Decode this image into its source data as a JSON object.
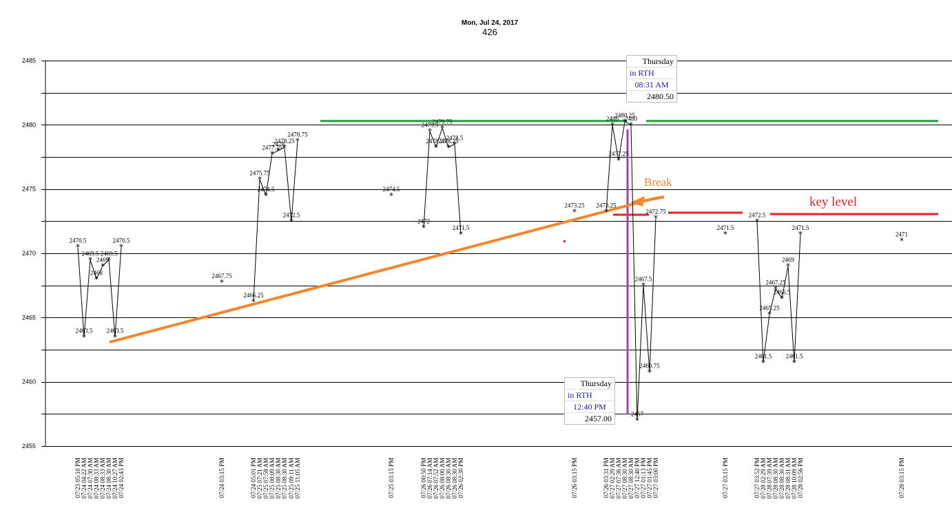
{
  "chart_data": {
    "type": "line",
    "title": "Mon, Jul 24, 2017",
    "subtitle": "426",
    "ylim": [
      2455,
      2485
    ],
    "y_ticks": [
      2455,
      2460,
      2465,
      2470,
      2475,
      2480,
      2485
    ],
    "grid": true,
    "points": [
      {
        "x": "07/23 05:10 PM",
        "y": 2470.5,
        "label": "2470.5"
      },
      {
        "x": "07/24 04:22 AM",
        "y": 2463.5,
        "label": "2463.5"
      },
      {
        "x": "07/24 07:30 AM",
        "y": 2469.5,
        "label": "2469.5"
      },
      {
        "x": "07/24 08:33 AM",
        "y": 2468,
        "label": "2468"
      },
      {
        "x": "07/24 08:33 AM",
        "y": 2469,
        "label": "2469"
      },
      {
        "x": "07/24 08:30 AM",
        "y": 2469.5,
        "label": "2469.5"
      },
      {
        "x": "07/24 10:27 AM",
        "y": 2463.5,
        "label": "2463.5"
      },
      {
        "x": "07/24 02:43 PM",
        "y": 2470.5,
        "label": "2470.5"
      },
      {
        "x": "07/24 03:15 PM",
        "y": 2467.75,
        "label": "2467.75",
        "isolated": true
      },
      {
        "x": "07/24 05:01 PM",
        "y": 2466.25,
        "label": "2466.25"
      },
      {
        "x": "07/25 07:21 AM",
        "y": 2475.75,
        "label": "2475.75"
      },
      {
        "x": "07/25 07:58 AM",
        "y": 2474.5,
        "label": "2474.5"
      },
      {
        "x": "07/25 08:09 AM",
        "y": 2477.75,
        "label": "2477.75"
      },
      {
        "x": "07/25 08:30 AM",
        "y": 2478,
        "label": "2478"
      },
      {
        "x": "07/25 08:30 AM",
        "y": 2478.25,
        "label": "2478.25"
      },
      {
        "x": "07/25 09:11 AM",
        "y": 2472.5,
        "label": "2472.5"
      },
      {
        "x": "07/25 11:05 AM",
        "y": 2478.75,
        "label": "2478.75"
      },
      {
        "x": "07/25 03:15 PM",
        "y": 2474.5,
        "label": "2474.5",
        "isolated": true
      },
      {
        "x": "07/26 00:50 PM",
        "y": 2472,
        "label": "2472"
      },
      {
        "x": "07/26 07:14 AM",
        "y": 2479.5,
        "label": "2479.5"
      },
      {
        "x": "07/26 07:52 AM",
        "y": 2478.25,
        "label": "2478.25"
      },
      {
        "x": "07/26 08:00 AM",
        "y": 2479.75,
        "label": "2479.75"
      },
      {
        "x": "07/26 08:30 AM",
        "y": 2478.25,
        "label": "2478.25"
      },
      {
        "x": "07/26 08:30 AM",
        "y": 2478.5,
        "label": "2478.5"
      },
      {
        "x": "07/26 02:30 PM",
        "y": 2471.5,
        "label": "2471.5"
      },
      {
        "x": "07/26 03:15 PM",
        "y": 2473.25,
        "label": "2473.25",
        "isolated": true
      },
      {
        "x": "07/26 03:31 PM",
        "y": 2473.25,
        "label": "2473.25"
      },
      {
        "x": "07/27 02:29 AM",
        "y": 2480,
        "label": "2480"
      },
      {
        "x": "07/27 07:36 AM",
        "y": 2477.25,
        "label": "2477.25"
      },
      {
        "x": "07/27 08:30 AM",
        "y": 2480.25,
        "label": "2480.25"
      },
      {
        "x": "07/27 08:30 AM",
        "y": 2480,
        "label": "2480"
      },
      {
        "x": "07/27 12:40 PM",
        "y": 2457,
        "label": "2457"
      },
      {
        "x": "07/27 01:13 PM",
        "y": 2467.5,
        "label": "2467.5"
      },
      {
        "x": "07/27 01:45 PM",
        "y": 2460.75,
        "label": "2460.75"
      },
      {
        "x": "07/27 03:00 PM",
        "y": 2472.75,
        "label": "2472.75"
      },
      {
        "x": "07/27 03:15 PM",
        "y": 2471.5,
        "label": "2471.5",
        "isolated": true
      },
      {
        "x": "07/27 03:52 PM",
        "y": 2472.5,
        "label": "2472.5"
      },
      {
        "x": "07/28 02:29 AM",
        "y": 2461.5,
        "label": "2461.5"
      },
      {
        "x": "07/28 07:39 AM",
        "y": 2465.25,
        "label": "2465.25"
      },
      {
        "x": "07/28 08:30 AM",
        "y": 2467.25,
        "label": "2467.25"
      },
      {
        "x": "07/28 08:30 AM",
        "y": 2466.5,
        "label": "2466.5"
      },
      {
        "x": "07/28 08:31 AM",
        "y": 2469,
        "label": "2469"
      },
      {
        "x": "07/28 10:09 AM",
        "y": 2461.5,
        "label": "2461.5"
      },
      {
        "x": "07/28 02:56 PM",
        "y": 2471.5,
        "label": "2471.5"
      },
      {
        "x": "07/28 03:15 PM",
        "y": 2471,
        "label": "2471",
        "isolated": true
      }
    ],
    "annotations": {
      "break_text": "Break",
      "key_level_text": "key level",
      "resistance_level": 2480.3,
      "key_level": 2473,
      "colors": {
        "trendline": "#f5862d",
        "resistance": "#22a33a",
        "key_level": "#e8202a",
        "vertical": "#a040b0",
        "line": "#000000"
      }
    },
    "tooltips": [
      {
        "day": "Thursday",
        "session": "in RTH",
        "time": "08:31 AM",
        "value": "2480.50"
      },
      {
        "day": "Thursday",
        "session": "in RTH",
        "time": "12:40 PM",
        "value": "2457.00"
      }
    ]
  }
}
